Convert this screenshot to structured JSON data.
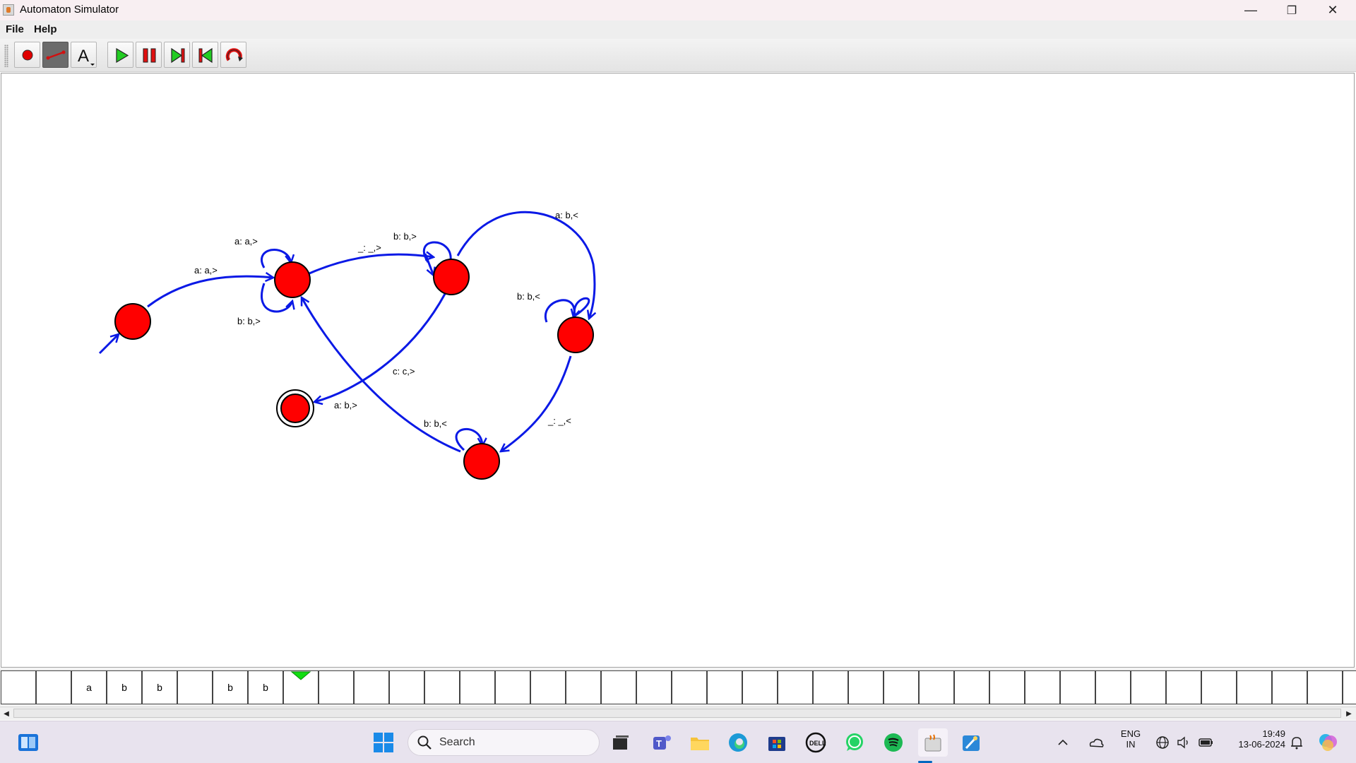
{
  "window": {
    "title": "Automaton Simulator",
    "minimize": "—",
    "maximize": "❐",
    "close": "✕"
  },
  "menu": {
    "file": "File",
    "help": "Help"
  },
  "toolbar": {
    "tools": [
      {
        "name": "state-tool",
        "icon": "red-dot-icon"
      },
      {
        "name": "transition-tool",
        "icon": "arrow-line-icon",
        "selected": true
      },
      {
        "name": "text-tool",
        "icon": "letter-a-icon"
      },
      {
        "name": "play",
        "icon": "play-icon"
      },
      {
        "name": "pause",
        "icon": "pause-icon"
      },
      {
        "name": "step-forward",
        "icon": "step-forward-icon"
      },
      {
        "name": "step-back",
        "icon": "step-back-icon"
      },
      {
        "name": "reset",
        "icon": "reset-icon"
      }
    ],
    "text_tool_glyph": "A"
  },
  "automaton": {
    "state_color": "#ff0000",
    "edge_color": "#0a19e6",
    "transitions": {
      "q0_q1": "a: a,>",
      "q1_loop_top": "a: a,>",
      "q1_loop_bottom": "b: b,>",
      "q1_q2": "_: _,>",
      "q2_loop": "b: b,>",
      "q2_q3": "a: b,<",
      "q3_loop": "b: b,<",
      "q3_q4": "_: _,<",
      "q4_loop": "b: b,<",
      "q4_q1": "a: b,>",
      "q2_q5": "c: c,>"
    }
  },
  "tape": {
    "cells": [
      "",
      "",
      "a",
      "b",
      "b",
      "",
      "b",
      "b",
      "",
      "",
      "",
      "",
      "",
      "",
      "",
      "",
      "",
      "",
      "",
      "",
      "",
      "",
      "",
      "",
      "",
      "",
      "",
      "",
      "",
      "",
      "",
      "",
      "",
      "",
      "",
      "",
      "",
      "",
      ""
    ],
    "head_index": 8,
    "head_color": "#11dd11"
  },
  "scrollbar": {
    "left": "◀",
    "right": "▶"
  },
  "taskbar": {
    "search_placeholder": "Search",
    "language": "ENG",
    "region": "IN",
    "time": "19:49",
    "date": "13-06-2024",
    "icons": [
      "widgets-icon",
      "windows-start-icon",
      "search-icon",
      "task-view-icon",
      "teams-icon",
      "file-explorer-icon",
      "edge-icon",
      "store-icon",
      "dell-icon",
      "whatsapp-icon",
      "spotify-icon",
      "java-icon",
      "paint-icon"
    ]
  }
}
